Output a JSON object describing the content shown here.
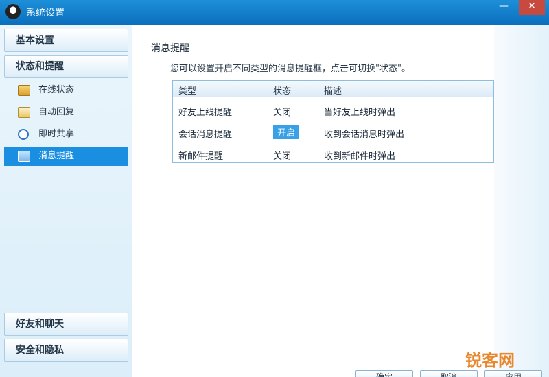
{
  "window": {
    "title": "系统设置",
    "min_glyph": "—",
    "close_glyph": "✕"
  },
  "sidebar": {
    "groups": [
      {
        "label": "基本设置"
      },
      {
        "label": "状态和提醒"
      },
      {
        "label": "好友和聊天"
      },
      {
        "label": "安全和隐私"
      }
    ],
    "items": [
      {
        "label": "在线状态",
        "icon": "status-card-icon"
      },
      {
        "label": "自动回复",
        "icon": "reply-icon"
      },
      {
        "label": "即时共享",
        "icon": "share-clock-icon"
      },
      {
        "label": "消息提醒",
        "icon": "message-icon"
      }
    ],
    "active_item": "消息提醒"
  },
  "main": {
    "section_title": "消息提醒",
    "description": "您可以设置开启不同类型的消息提醒框，点击可切换\"状态\"。",
    "table": {
      "headers": [
        "类型",
        "状态",
        "描述"
      ],
      "rows": [
        {
          "type": "好友上线提醒",
          "status": "关闭",
          "desc": "当好友上线时弹出"
        },
        {
          "type": "会话消息提醒",
          "status": "开启",
          "desc": "收到会话消息时弹出"
        },
        {
          "type": "新邮件提醒",
          "status": "关闭",
          "desc": "收到新邮件时弹出"
        }
      ]
    }
  },
  "footer": {
    "buttons": [
      "确定",
      "取消",
      "应用"
    ]
  },
  "watermark": "锐客网",
  "colors": {
    "titlebar": "#0b6fbe",
    "active_item": "#1a8ee0",
    "status_on": "#3aa0e6"
  }
}
